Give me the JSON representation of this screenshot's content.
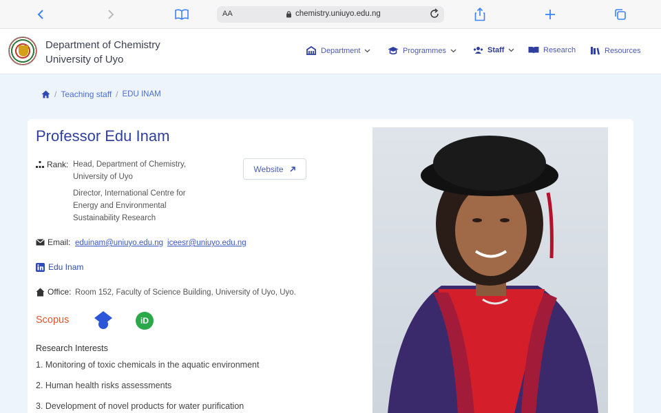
{
  "browser": {
    "aa_label": "AA",
    "url": "chemistry.uniuyo.edu.ng"
  },
  "header": {
    "title_line1": "Department of Chemistry",
    "title_line2": "University of Uyo",
    "nav": [
      {
        "label": "Department",
        "icon": "building-icon"
      },
      {
        "label": "Programmes",
        "icon": "graduation-cap-icon"
      },
      {
        "label": "Staff",
        "icon": "users-icon"
      },
      {
        "label": "Research",
        "icon": "book-open-icon"
      },
      {
        "label": "Resources",
        "icon": "library-icon"
      }
    ]
  },
  "breadcrumb": {
    "home_icon": "home-icon",
    "teaching_staff": "Teaching staff",
    "current": "EDU INAM"
  },
  "profile": {
    "name": "Professor Edu Inam",
    "rank_label": "Rank:",
    "rank_line1": "Head, Department of Chemistry,",
    "rank_line2": "University of Uyo",
    "director_line1": "Director, International Centre for",
    "director_line2": "Energy and Environmental",
    "director_line3": "Sustainability Research",
    "website_label": "Website",
    "email_label": "Email:",
    "email1": "eduinam@uniuyo.edu.ng",
    "email2": "iceesr@uniuyo.edu.ng",
    "linkedin": "Edu Inam",
    "office_label": "Office:",
    "office": "Room 152, Faculty of Science Building, University of Uyo, Uyo.",
    "scopus": "Scopus",
    "orcid": "iD",
    "research_title": "Research Interests",
    "research": [
      "1. Monitoring of toxic chemicals in the aquatic environment",
      "2. Human health risks assessments",
      "3. Development of novel products for water purification"
    ]
  },
  "colors": {
    "accent": "#2f3fa0",
    "scopus": "#e0572a",
    "orcid": "#2aa84a"
  }
}
